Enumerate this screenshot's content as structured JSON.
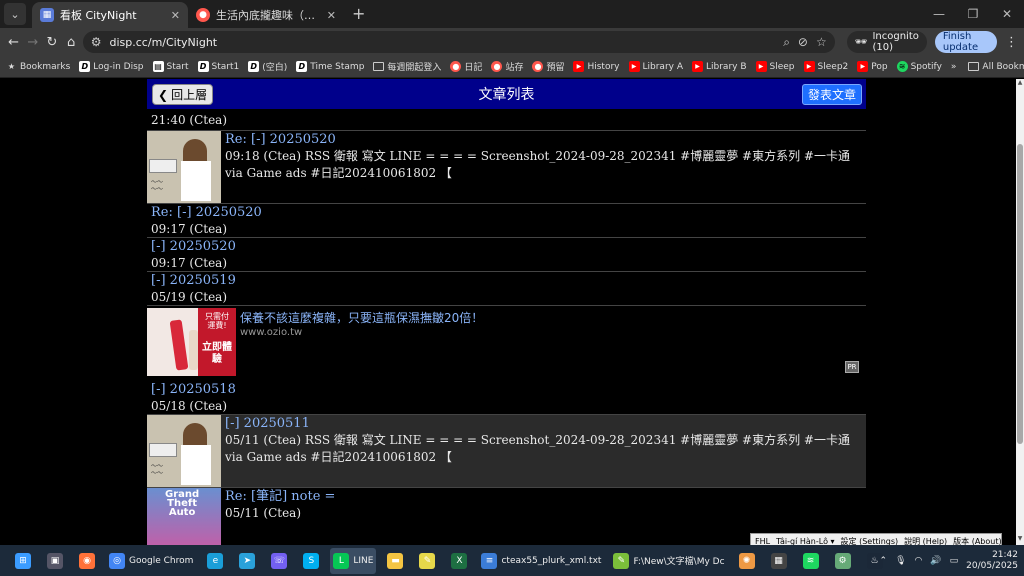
{
  "browser": {
    "tabs": [
      {
        "title": "看板 CityNight",
        "active": true
      },
      {
        "title": "生活內底攏趣味（生活中找樂趣）",
        "active": false
      }
    ],
    "new_tab": "+",
    "url": "disp.cc/m/CityNight",
    "incognito_label": "Incognito (10)",
    "finish_update": "Finish update",
    "bookmarks": [
      {
        "label": "Bookmarks",
        "icon": "star-icon"
      },
      {
        "label": "Log-in Disp",
        "icon": "d-icon"
      },
      {
        "label": "Start",
        "icon": "start-icon"
      },
      {
        "label": "Start1",
        "icon": "d-icon"
      },
      {
        "label": "(空白)",
        "icon": "d-icon"
      },
      {
        "label": "Time Stamp",
        "icon": "d-icon"
      },
      {
        "label": "每週開起登入",
        "icon": "folder-icon"
      },
      {
        "label": "日記",
        "icon": "plurk-icon"
      },
      {
        "label": "站存",
        "icon": "plurk-icon"
      },
      {
        "label": "預留",
        "icon": "plurk-icon"
      },
      {
        "label": "History",
        "icon": "youtube-icon"
      },
      {
        "label": "Library A",
        "icon": "youtube-icon"
      },
      {
        "label": "Library B",
        "icon": "youtube-icon"
      },
      {
        "label": "Sleep",
        "icon": "youtube-icon"
      },
      {
        "label": "Sleep2",
        "icon": "youtube-icon"
      },
      {
        "label": "Pop",
        "icon": "youtube-icon"
      },
      {
        "label": "Spotify",
        "icon": "spotify-icon"
      }
    ],
    "more_bookmarks": "»",
    "all_bookmarks": "All Bookmarks"
  },
  "page": {
    "back_label": "回上層",
    "title": "文章列表",
    "post_label": "發表文章",
    "rows_top": [
      {
        "title": "",
        "meta": "21:40 (Ctea)",
        "thumb": false,
        "gray": false,
        "partial": true
      },
      {
        "title": "Re: [-] 20250520",
        "meta": "09:18 (Ctea) RSS 衛報 寫文 LINE = = = = Screenshot_2024-09-28_202341 #博麗靈夢 #東方系列 #一卡通",
        "meta2": "via Game ads #日記202410061802 【",
        "thumb": true,
        "gray": false
      },
      {
        "title": "Re: [-] 20250520",
        "meta": "09:17 (Ctea)",
        "thumb": false,
        "gray": false
      },
      {
        "title": "[-] 20250520",
        "meta": "09:17 (Ctea)",
        "thumb": false,
        "gray": false
      },
      {
        "title": "[-] 20250519",
        "meta": "05/19 (Ctea)",
        "thumb": false,
        "gray": false
      }
    ],
    "ad": {
      "title": "保養不該這麼複雜，只要這瓶保濕撫皺20倍！",
      "url": "www.ozio.tw",
      "tag_top": "只需付運費!",
      "tag_cta": "立即體驗",
      "pr": "PR"
    },
    "rows_bottom": [
      {
        "title": "[-] 20250518",
        "meta": "05/18 (Ctea)",
        "thumb": false,
        "gray": false
      },
      {
        "title": "[-] 20250511",
        "meta": "05/11 (Ctea) RSS 衛報 寫文 LINE = = = = Screenshot_2024-09-28_202341 #博麗靈夢 #東方系列 #一卡通",
        "meta2": "via Game ads #日記202410061802 【",
        "thumb": true,
        "gray": true
      },
      {
        "title": "Re: [筆記] note =",
        "meta": "05/11 (Ctea)",
        "thumb": true,
        "thumbStyle": "gta",
        "gray": false
      }
    ]
  },
  "ime": {
    "items": [
      "FHL",
      "Tâi-gí Hàn-Lô ▾",
      "設定 (Settings)",
      "說明 (Help)",
      "版本 (About)"
    ]
  },
  "taskbar": {
    "apps": [
      {
        "label": "",
        "icon": "windows-icon",
        "color": "#3b9cff"
      },
      {
        "label": "",
        "icon": "taskview-icon",
        "color": "#556"
      },
      {
        "label": "",
        "icon": "firefox-icon",
        "color": "#ff7139"
      },
      {
        "label": "Google Chrom",
        "icon": "chrome-icon",
        "color": "#4285f4"
      },
      {
        "label": "",
        "icon": "edge-icon",
        "color": "#1a9ed8"
      },
      {
        "label": "",
        "icon": "telegram-icon",
        "color": "#2aa1da"
      },
      {
        "label": "",
        "icon": "viber-icon",
        "color": "#7360f2"
      },
      {
        "label": "",
        "icon": "skype-icon",
        "color": "#00aff0"
      },
      {
        "label": "LINE",
        "icon": "line-icon",
        "color": "#06c755",
        "active": true
      },
      {
        "label": "",
        "icon": "folder-icon",
        "color": "#f4c542"
      },
      {
        "label": "",
        "icon": "sticky-icon",
        "color": "#e6d84a"
      },
      {
        "label": "",
        "icon": "excel-icon",
        "color": "#1d6f42"
      },
      {
        "label": "cteax55_plurk_xml.txt",
        "icon": "notepad-icon",
        "color": "#3b7dd8"
      },
      {
        "label": "F:\\New\\文字檔\\My Dc",
        "icon": "notepadpp-icon",
        "color": "#7bbf3a"
      },
      {
        "label": "",
        "icon": "pinwheel-icon",
        "color": "#e94"
      },
      {
        "label": "",
        "icon": "clapper-icon",
        "color": "#444"
      },
      {
        "label": "",
        "icon": "spotify-icon",
        "color": "#1ed760"
      },
      {
        "label": "",
        "icon": "gear-icon",
        "color": "#6a7"
      },
      {
        "label": "",
        "icon": "steam-icon",
        "color": "#1b2838"
      }
    ],
    "time": "21:42",
    "date": "20/05/2025"
  }
}
